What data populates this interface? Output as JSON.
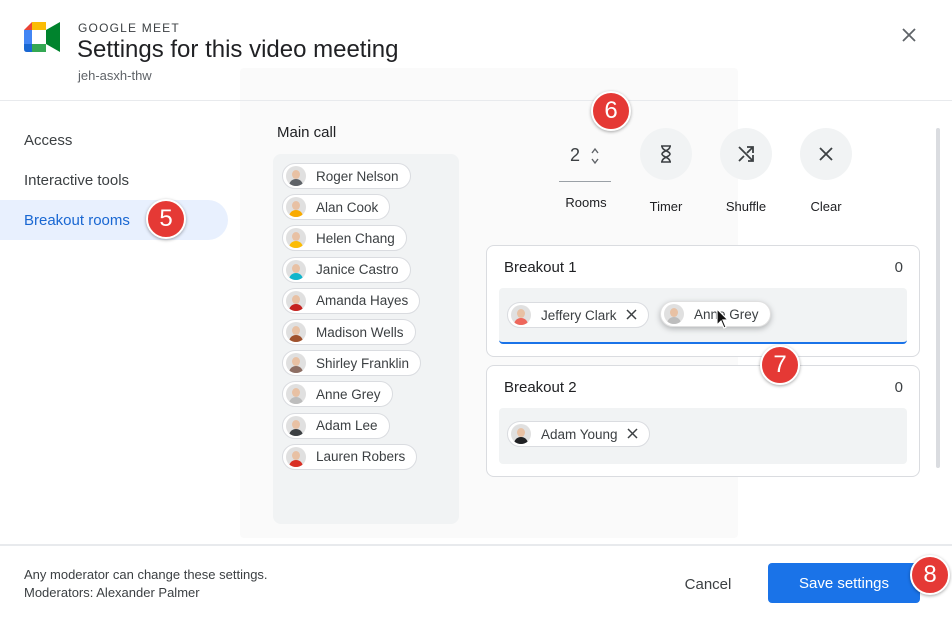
{
  "header": {
    "brand": "GOOGLE MEET",
    "title": "Settings for this video meeting",
    "meeting_code": "jeh-asxh-thw"
  },
  "sidebar": {
    "items": [
      {
        "label": "Access",
        "active": false
      },
      {
        "label": "Interactive tools",
        "active": false
      },
      {
        "label": "Breakout rooms",
        "active": true
      }
    ]
  },
  "main_call": {
    "label": "Main call",
    "participants": [
      {
        "name": "Roger Nelson",
        "avatar_color": "#5f6368"
      },
      {
        "name": "Alan Cook",
        "avatar_color": "#f9ab00"
      },
      {
        "name": "Helen Chang",
        "avatar_color": "#fbbc04"
      },
      {
        "name": "Janice Castro",
        "avatar_color": "#12b5cb"
      },
      {
        "name": "Amanda Hayes",
        "avatar_color": "#c5221f"
      },
      {
        "name": "Madison Wells",
        "avatar_color": "#a0522d"
      },
      {
        "name": "Shirley Franklin",
        "avatar_color": "#8d6e63"
      },
      {
        "name": "Anne Grey",
        "avatar_color": "#bdbdbd"
      },
      {
        "name": "Adam Lee",
        "avatar_color": "#3c4043"
      },
      {
        "name": "Lauren Robers",
        "avatar_color": "#d93025"
      }
    ]
  },
  "toolbar": {
    "rooms_value": "2",
    "rooms_label": "Rooms",
    "timer_label": "Timer",
    "shuffle_label": "Shuffle",
    "clear_label": "Clear"
  },
  "breakout_rooms": [
    {
      "name": "Breakout 1",
      "count": "0",
      "participants": [
        {
          "name": "Jeffery Clark",
          "avatar_color": "#ee675c"
        },
        {
          "name": "Anne Grey",
          "avatar_color": "#bdbdbd"
        }
      ]
    },
    {
      "name": "Breakout 2",
      "count": "0",
      "participants": [
        {
          "name": "Adam Young",
          "avatar_color": "#202124"
        }
      ]
    }
  ],
  "footer": {
    "note_line1": "Any moderator can change these settings.",
    "note_line2": "Moderators: Alexander Palmer",
    "cancel_label": "Cancel",
    "save_label": "Save settings"
  },
  "markers": [
    "5",
    "6",
    "7",
    "8"
  ],
  "colors": {
    "accent": "#1a73e8",
    "marker": "#e53935",
    "active_nav_bg": "#e8f0fe"
  }
}
